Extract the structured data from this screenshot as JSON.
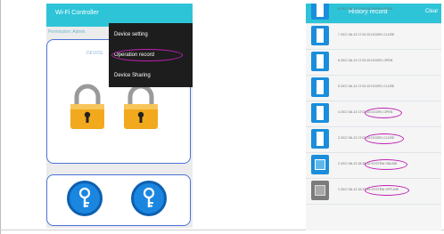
{
  "left_phone": {
    "title": "Wi-Fi Controller",
    "permission": "Permission: Admin",
    "device_label": "DEVICE",
    "menu": {
      "items": [
        "Device setting",
        "Operation record",
        "Device Sharing"
      ],
      "highlighted_item": "Operation record"
    },
    "icons": [
      "padlock-icon",
      "padlock-icon",
      "key-icon",
      "key-icon"
    ]
  },
  "right_phone": {
    "title": "History record",
    "clear_label": "Clear",
    "rows": [
      {
        "text": "8  2017-06-13 17:02:15 DOOR1 OPEN",
        "icon": "door-icon",
        "highlight": false
      },
      {
        "text": "7  2017-06-13 17:02:15 DOOR1 CLOSE",
        "icon": "door-icon",
        "highlight": false
      },
      {
        "text": "6  2017-06-13 17:02:15 DOOR1 OPEN",
        "icon": "door-icon",
        "highlight": false
      },
      {
        "text": "5  2017-06-13 17:02:15 DOOR1 CLOSE",
        "icon": "door-icon",
        "highlight": false
      },
      {
        "text": "4  2017-06-13 17:02:15 DOOR1 OPEN",
        "icon": "door-icon",
        "highlight": true
      },
      {
        "text": "3  2017-06-13 17:02:15 DOOR1 CLOSE",
        "icon": "door-icon",
        "highlight": true
      },
      {
        "text": "2  2017-06-13 16:38:15 SYSTEM ONLINE",
        "icon": "system-icon",
        "highlight": true
      },
      {
        "text": "1  2017-06-13 16:37:45 SYSTEM OFFLINE",
        "icon": "system-offline-icon",
        "highlight": true
      }
    ]
  },
  "colors": {
    "header": "#2ec4d8",
    "accent_blue": "#1a86e0",
    "highlight_circle": "#c01fb4",
    "panel_border": "#4a72d6"
  }
}
